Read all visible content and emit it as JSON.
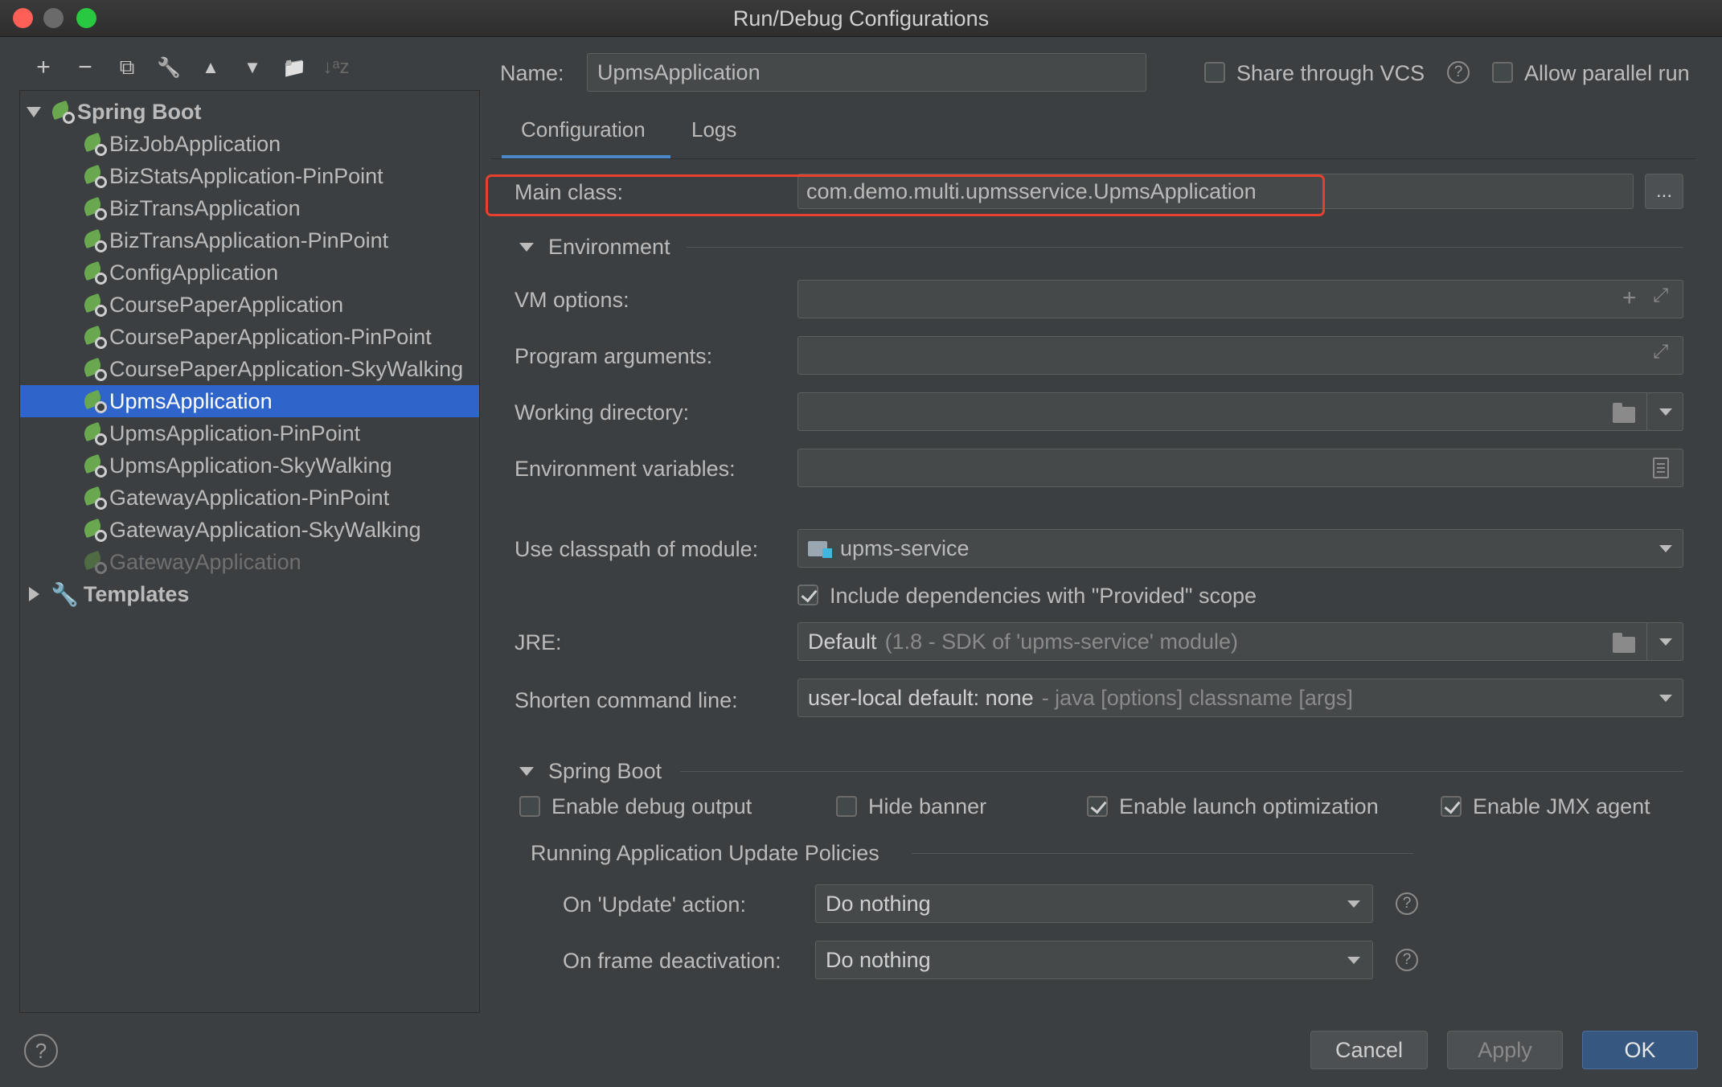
{
  "window": {
    "title": "Run/Debug Configurations"
  },
  "toolbar": {
    "add": "+",
    "remove": "−",
    "copy": "⧉",
    "edit": "🔧",
    "up": "▲",
    "down": "▼",
    "folder": "📁",
    "sort": "↓ᵃz"
  },
  "tree": {
    "group_label": "Spring Boot",
    "items": [
      "BizJobApplication",
      "BizStatsApplication-PinPoint",
      "BizTransApplication",
      "BizTransApplication-PinPoint",
      "ConfigApplication",
      "CoursePaperApplication",
      "CoursePaperApplication-PinPoint",
      "CoursePaperApplication-SkyWalking",
      "UpmsApplication",
      "UpmsApplication-PinPoint",
      "UpmsApplication-SkyWalking",
      "GatewayApplication-PinPoint",
      "GatewayApplication-SkyWalking",
      "GatewayApplication"
    ],
    "selected_index": 8,
    "templates_label": "Templates"
  },
  "header": {
    "name_label": "Name:",
    "name_value": "UpmsApplication",
    "share_vcs_label": "Share through VCS",
    "parallel_label": "Allow parallel run"
  },
  "tabs": {
    "configuration": "Configuration",
    "logs": "Logs"
  },
  "config": {
    "main_class_label": "Main class:",
    "main_class_value": "com.demo.multi.upmsservice.UpmsApplication",
    "dots": "...",
    "environment_label": "Environment",
    "vm_options_label": "VM options:",
    "program_args_label": "Program arguments:",
    "working_dir_label": "Working directory:",
    "env_vars_label": "Environment variables:",
    "classpath_label": "Use classpath of module:",
    "classpath_value": "upms-service",
    "include_deps_label": "Include dependencies with \"Provided\" scope",
    "jre_label": "JRE:",
    "jre_value": "Default",
    "jre_hint": "(1.8 - SDK of 'upms-service' module)",
    "shorten_label": "Shorten command line:",
    "shorten_value": "user-local default: none",
    "shorten_hint": "- java [options] classname [args]"
  },
  "spring_boot": {
    "section_label": "Spring Boot",
    "debug_output": "Enable debug output",
    "hide_banner": "Hide banner",
    "launch_opt": "Enable launch optimization",
    "jmx_agent": "Enable JMX agent",
    "policies_label": "Running Application Update Policies",
    "update_label": "On 'Update' action:",
    "update_value": "Do nothing",
    "frame_label": "On frame deactivation:",
    "frame_value": "Do nothing"
  },
  "footer": {
    "help": "?",
    "cancel": "Cancel",
    "apply": "Apply",
    "ok": "OK"
  },
  "colors": {
    "selection": "#2f65ca",
    "highlight": "#e8402e",
    "primary_button": "#365880"
  }
}
